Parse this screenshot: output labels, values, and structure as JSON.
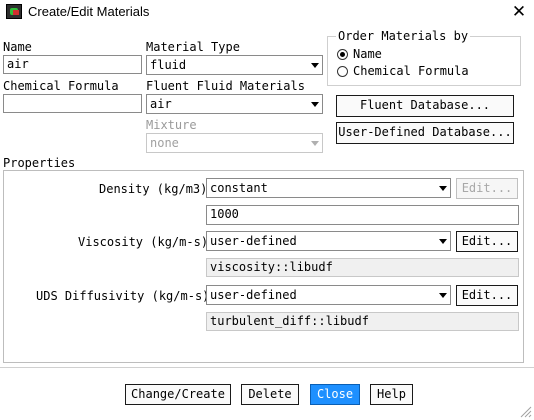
{
  "window": {
    "title": "Create/Edit Materials",
    "close_glyph": "✕",
    "icon": "fluent-app-icon"
  },
  "name": {
    "label": "Name",
    "value": "air"
  },
  "material_type": {
    "label": "Material Type",
    "value": "fluid"
  },
  "chemical_formula": {
    "label": "Chemical Formula",
    "value": ""
  },
  "fluent_fluid_materials": {
    "label": "Fluent Fluid Materials",
    "value": "air"
  },
  "mixture": {
    "label": "Mixture",
    "value": "none"
  },
  "order_by": {
    "label": "Order Materials by",
    "options": [
      "Name",
      "Chemical Formula"
    ],
    "selected": "Name"
  },
  "buttons": {
    "fluent_database": "Fluent Database...",
    "user_defined_database": "User-Defined Database...",
    "change_create": "Change/Create",
    "delete": "Delete",
    "close": "Close",
    "help": "Help"
  },
  "properties": {
    "label": "Properties",
    "density": {
      "label": "Density (kg/m3)",
      "method": "constant",
      "value": "1000",
      "edit": "Edit..."
    },
    "viscosity": {
      "label": "Viscosity (kg/m-s)",
      "method": "user-defined",
      "value": "viscosity::libudf",
      "edit": "Edit..."
    },
    "uds_diffusivity": {
      "label": "UDS Diffusivity (kg/m-s)",
      "method": "user-defined",
      "value": "turbulent_diff::libudf",
      "edit": "Edit..."
    }
  },
  "colors": {
    "accent": "#1e90ff"
  }
}
